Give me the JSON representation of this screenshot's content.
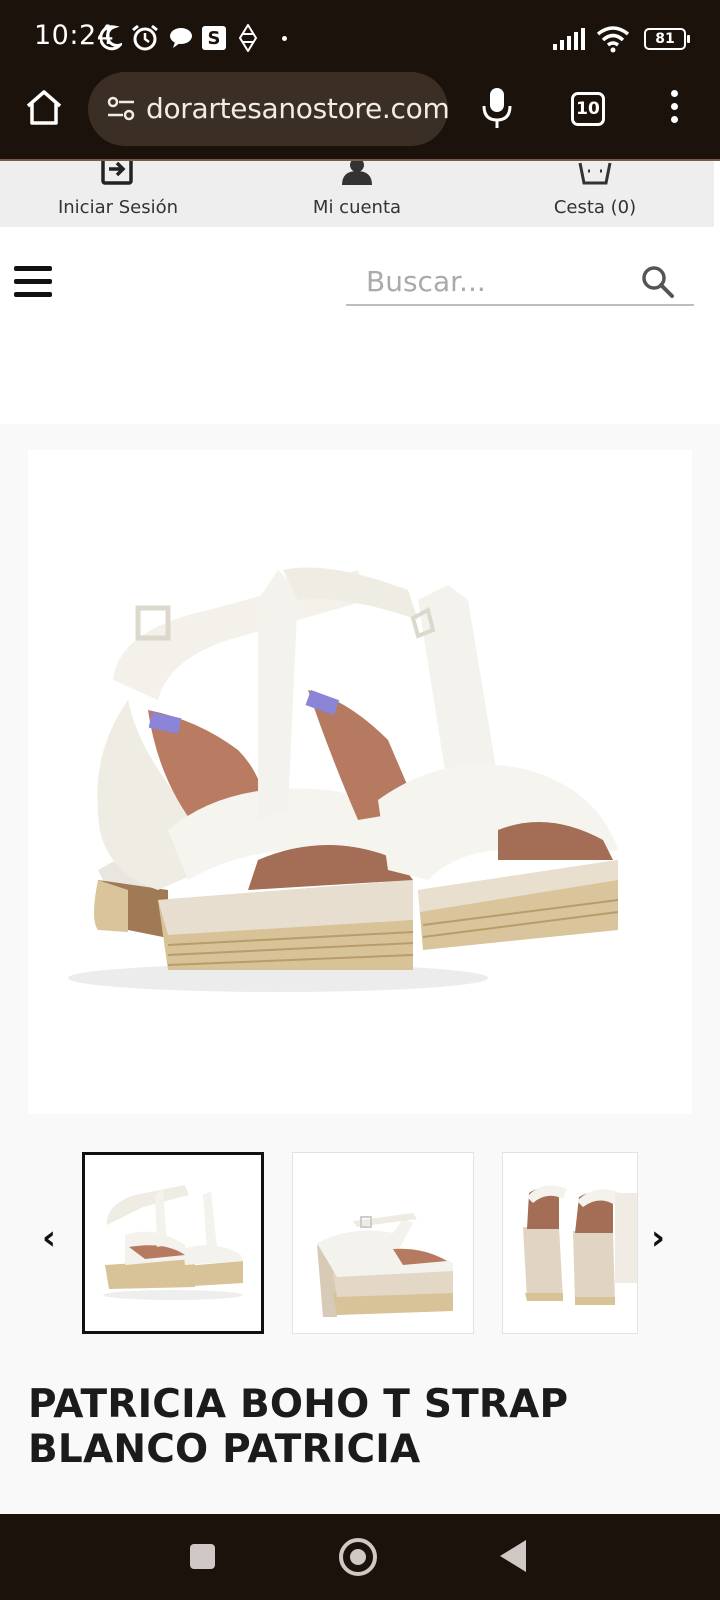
{
  "status_bar": {
    "time": "10:24",
    "icons_left": [
      "moon-icon",
      "alarm-icon",
      "chat-bubble-icon",
      "s-app-icon",
      "signal-diamond-icon",
      "dot-icon"
    ],
    "s_badge": "S",
    "icons_right": [
      "cellular-signal-icon",
      "wifi-icon",
      "battery-icon"
    ],
    "battery": "81"
  },
  "browser": {
    "url": "dorartesanostore.com",
    "tab_count": "10"
  },
  "site_top": {
    "login_label": "Iniciar Sesión",
    "account_label": "Mi cuenta",
    "cart_label": "Cesta (0)"
  },
  "search": {
    "placeholder": "Buscar..."
  },
  "product": {
    "title": "PATRICIA BOHO T STRAP BLANCO PATRICIA",
    "thumbnails": [
      "front-pair-view",
      "side-view",
      "back-view"
    ],
    "prev_arrow": "‹",
    "next_arrow": "›"
  },
  "colors": {
    "system_bar": "#1c120c",
    "url_box": "#3b2e24",
    "site_top_bg": "#eeeeee",
    "gallery_bg": "#f9f9f9"
  }
}
